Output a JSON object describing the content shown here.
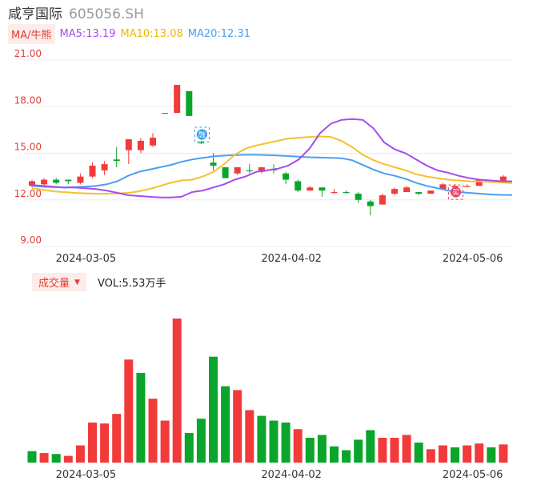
{
  "header": {
    "name": "咸亨国际",
    "code": "605056.SH"
  },
  "ma_legend": {
    "tag": "MA/牛熊",
    "ma5": "MA5:13.19",
    "ma10": "MA10:13.08",
    "ma20": "MA20:12.31"
  },
  "volume_legend": {
    "tag": "成交量",
    "value": "VOL:5.53万手"
  },
  "colors": {
    "up": "#f23a3a",
    "down": "#0aa52b",
    "ma5": "#a64bf0",
    "ma10": "#f2c22c",
    "ma20": "#4a9ef0",
    "doji_down": "#2a9f76"
  },
  "chart_data": [
    {
      "type": "candlestick",
      "y_ticks": [
        "21.00",
        "18.00",
        "15.00",
        "12.00",
        "9.00"
      ],
      "ylim": [
        9,
        21
      ],
      "x_tick_labels": [
        "2024-03-05",
        "2024-04-02",
        "2024-05-06"
      ],
      "x_tick_index": [
        4,
        21,
        36
      ],
      "candles": [
        {
          "o": 13.2,
          "h": 13.3,
          "l": 12.8,
          "c": 12.9,
          "d": "up"
        },
        {
          "o": 13.0,
          "h": 13.4,
          "l": 12.9,
          "c": 13.3,
          "d": "up"
        },
        {
          "o": 13.3,
          "h": 13.4,
          "l": 13.0,
          "c": 13.1,
          "d": "down"
        },
        {
          "o": 13.2,
          "h": 13.3,
          "l": 13.0,
          "c": 13.3,
          "d": "down"
        },
        {
          "o": 13.1,
          "h": 13.7,
          "l": 13.0,
          "c": 13.5,
          "d": "up"
        },
        {
          "o": 13.5,
          "h": 14.4,
          "l": 13.4,
          "c": 14.2,
          "d": "up"
        },
        {
          "o": 13.9,
          "h": 14.5,
          "l": 13.6,
          "c": 14.3,
          "d": "up"
        },
        {
          "o": 14.6,
          "h": 15.4,
          "l": 14.1,
          "c": 14.5,
          "d": "down"
        },
        {
          "o": 15.2,
          "h": 15.9,
          "l": 14.3,
          "c": 15.9,
          "d": "up"
        },
        {
          "o": 15.2,
          "h": 16.0,
          "l": 15.0,
          "c": 15.8,
          "d": "up"
        },
        {
          "o": 15.5,
          "h": 16.3,
          "l": 15.4,
          "c": 16.0,
          "d": "up"
        },
        {
          "o": 17.6,
          "h": 17.6,
          "l": 17.6,
          "c": 17.6,
          "d": "up"
        },
        {
          "o": 17.6,
          "h": 19.4,
          "l": 17.6,
          "c": 19.4,
          "d": "up"
        },
        {
          "o": 19.0,
          "h": 19.0,
          "l": 17.4,
          "c": 17.4,
          "d": "down"
        },
        {
          "o": 15.7,
          "h": 15.8,
          "l": 15.6,
          "c": 15.7,
          "d": "down"
        },
        {
          "o": 14.4,
          "h": 15.0,
          "l": 13.9,
          "c": 14.2,
          "d": "down"
        },
        {
          "o": 14.1,
          "h": 14.1,
          "l": 13.4,
          "c": 13.4,
          "d": "down"
        },
        {
          "o": 13.7,
          "h": 14.0,
          "l": 13.6,
          "c": 14.1,
          "d": "up"
        },
        {
          "o": 13.9,
          "h": 14.3,
          "l": 13.7,
          "c": 13.9,
          "d": "down"
        },
        {
          "o": 13.8,
          "h": 14.0,
          "l": 13.7,
          "c": 14.1,
          "d": "up"
        },
        {
          "o": 13.9,
          "h": 14.3,
          "l": 13.7,
          "c": 14.0,
          "d": "down"
        },
        {
          "o": 13.7,
          "h": 13.8,
          "l": 13.0,
          "c": 13.3,
          "d": "down"
        },
        {
          "o": 13.2,
          "h": 13.3,
          "l": 12.5,
          "c": 12.6,
          "d": "down"
        },
        {
          "o": 12.6,
          "h": 12.9,
          "l": 12.6,
          "c": 12.8,
          "d": "up"
        },
        {
          "o": 12.8,
          "h": 12.8,
          "l": 12.2,
          "c": 12.6,
          "d": "down"
        },
        {
          "o": 12.5,
          "h": 12.7,
          "l": 12.4,
          "c": 12.5,
          "d": "up"
        },
        {
          "o": 12.5,
          "h": 12.6,
          "l": 12.4,
          "c": 12.5,
          "d": "down"
        },
        {
          "o": 12.4,
          "h": 12.5,
          "l": 11.8,
          "c": 12.0,
          "d": "down"
        },
        {
          "o": 11.9,
          "h": 12.0,
          "l": 11.0,
          "c": 11.6,
          "d": "down"
        },
        {
          "o": 11.7,
          "h": 12.4,
          "l": 11.7,
          "c": 12.3,
          "d": "up"
        },
        {
          "o": 12.4,
          "h": 12.8,
          "l": 12.3,
          "c": 12.7,
          "d": "up"
        },
        {
          "o": 12.5,
          "h": 12.9,
          "l": 12.5,
          "c": 12.8,
          "d": "up"
        },
        {
          "o": 12.5,
          "h": 12.5,
          "l": 12.3,
          "c": 12.4,
          "d": "down"
        },
        {
          "o": 12.4,
          "h": 12.6,
          "l": 12.4,
          "c": 12.6,
          "d": "up"
        },
        {
          "o": 12.7,
          "h": 13.1,
          "l": 12.7,
          "c": 13.0,
          "d": "up"
        },
        {
          "o": 12.9,
          "h": 13.0,
          "l": 12.7,
          "c": 12.8,
          "d": "up"
        },
        {
          "o": 12.9,
          "h": 13.0,
          "l": 12.8,
          "c": 12.9,
          "d": "up"
        },
        {
          "o": 12.9,
          "h": 13.3,
          "l": 12.9,
          "c": 13.3,
          "d": "up"
        },
        {
          "o": 13.2,
          "h": 13.3,
          "l": 13.1,
          "c": 13.2,
          "d": "down"
        },
        {
          "o": 13.2,
          "h": 13.6,
          "l": 13.2,
          "c": 13.5,
          "d": "up"
        }
      ],
      "ma5": [
        12.95,
        12.9,
        12.85,
        12.8,
        12.8,
        12.75,
        12.7,
        12.6,
        12.45,
        12.3,
        12.25,
        12.2,
        12.15,
        12.15,
        12.2,
        12.5,
        12.6,
        12.8,
        13.0,
        13.3,
        13.5,
        13.8,
        13.9,
        14.0,
        14.2,
        14.6,
        15.3,
        16.3,
        16.9,
        17.15,
        17.2,
        17.15,
        16.6,
        15.7,
        15.25,
        15.0,
        14.6,
        14.2,
        13.9,
        13.75,
        13.55,
        13.4,
        13.3,
        13.25,
        13.2,
        13.19
      ],
      "ma10": [
        12.75,
        12.65,
        12.55,
        12.5,
        12.45,
        12.42,
        12.4,
        12.4,
        12.42,
        12.45,
        12.55,
        12.7,
        12.9,
        13.1,
        13.25,
        13.3,
        13.5,
        13.8,
        14.3,
        14.9,
        15.3,
        15.5,
        15.65,
        15.8,
        15.95,
        16.0,
        16.05,
        16.08,
        16.05,
        15.8,
        15.4,
        14.9,
        14.55,
        14.3,
        14.1,
        13.9,
        13.65,
        13.5,
        13.4,
        13.3,
        13.25,
        13.2,
        13.18,
        13.15,
        13.12,
        13.08
      ],
      "ma20": [
        12.9,
        12.85,
        12.82,
        12.8,
        12.82,
        12.85,
        12.9,
        13.0,
        13.2,
        13.55,
        13.8,
        13.95,
        14.1,
        14.25,
        14.45,
        14.6,
        14.7,
        14.8,
        14.85,
        14.88,
        14.9,
        14.9,
        14.88,
        14.86,
        14.82,
        14.78,
        14.74,
        14.72,
        14.7,
        14.68,
        14.55,
        14.25,
        13.95,
        13.7,
        13.55,
        13.35,
        13.1,
        12.9,
        12.75,
        12.6,
        12.5,
        12.45,
        12.4,
        12.35,
        12.32,
        12.31
      ],
      "markers": [
        {
          "label": "融",
          "index": 14,
          "color": "#2f9bf0"
        },
        {
          "label": "买",
          "index": 35,
          "color": "#e8436a"
        }
      ]
    },
    {
      "type": "bar",
      "title": "成交量",
      "values": [
        1.2,
        1.0,
        0.9,
        0.7,
        1.8,
        4.2,
        4.1,
        5.1,
        10.8,
        9.4,
        6.7,
        4.4,
        15.1,
        3.1,
        4.6,
        11.1,
        8.0,
        7.6,
        5.5,
        4.9,
        4.4,
        4.2,
        3.5,
        2.6,
        2.9,
        1.7,
        1.3,
        2.4,
        3.4,
        2.6,
        2.6,
        2.9,
        2.1,
        1.4,
        1.8,
        1.6,
        1.8,
        2.0,
        1.6,
        1.9
      ],
      "colors": [
        "down",
        "up",
        "down",
        "up",
        "up",
        "up",
        "up",
        "up",
        "up",
        "down",
        "up",
        "up",
        "up",
        "down",
        "down",
        "down",
        "down",
        "up",
        "up",
        "down",
        "down",
        "down",
        "up",
        "down",
        "down",
        "down",
        "down",
        "down",
        "down",
        "up",
        "up",
        "up",
        "down",
        "up",
        "up",
        "down",
        "up",
        "up",
        "down",
        "up"
      ]
    }
  ]
}
